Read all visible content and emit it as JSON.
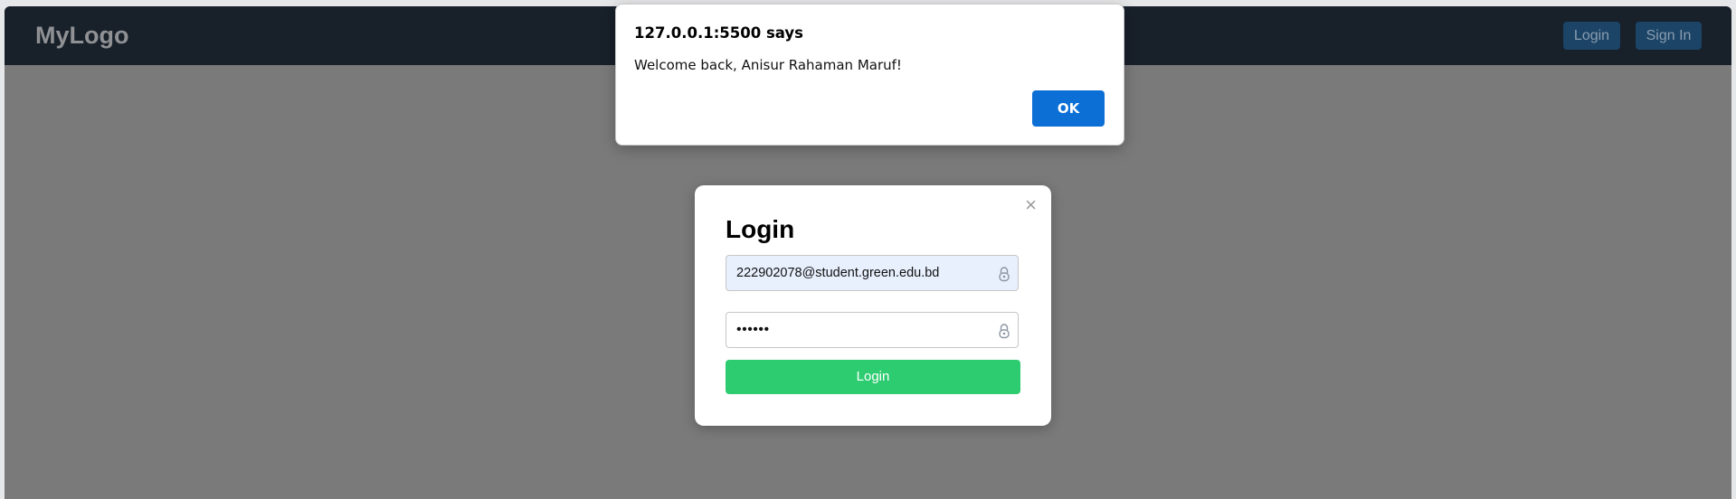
{
  "navbar": {
    "logo": "MyLogo",
    "login_label": "Login",
    "signin_label": "Sign In"
  },
  "modal": {
    "title": "Login",
    "close_glyph": "×",
    "email_value": "222902078@student.green.edu.bd",
    "password_value": "••••••",
    "submit_label": "Login",
    "field_icon": "lock-icon"
  },
  "alert": {
    "title": "127.0.0.1:5500 says",
    "message": "Welcome back, Anisur Rahaman Maruf!",
    "ok_label": "OK"
  },
  "colors": {
    "navbar_bg": "#18202a",
    "overlay": "#7a7a7a",
    "nav_button": "#1b4466",
    "submit_button": "#2ecc71",
    "alert_ok": "#0b6fd6",
    "autofill_bg": "#e8f0fe"
  }
}
